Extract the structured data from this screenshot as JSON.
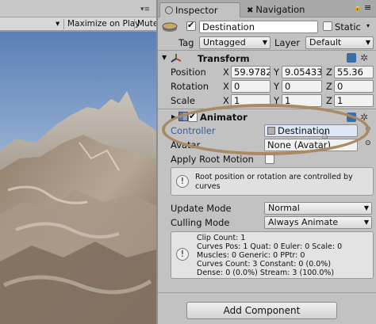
{
  "game_toolbar": {
    "dropdown": "",
    "maximize": "Maximize on Play",
    "mute": "Mute"
  },
  "tabs": {
    "inspector": "Inspector",
    "navigation": "Navigation"
  },
  "object": {
    "name": "Destination",
    "static_label": "Static",
    "tag_label": "Tag",
    "tag_value": "Untagged",
    "layer_label": "Layer",
    "layer_value": "Default"
  },
  "transform": {
    "title": "Transform",
    "position_label": "Position",
    "rotation_label": "Rotation",
    "scale_label": "Scale",
    "axis_x": "X",
    "axis_y": "Y",
    "axis_z": "Z",
    "position": [
      "59.9782",
      "9.05433",
      "55.36"
    ],
    "rotation": [
      "0",
      "0",
      "0"
    ],
    "scale": [
      "1",
      "1",
      "1"
    ]
  },
  "animator": {
    "title": "Animator",
    "controller_label": "Controller",
    "controller_value": "Destination",
    "avatar_label": "Avatar",
    "avatar_value": "None (Avatar)",
    "apply_root_motion_label": "Apply Root Motion",
    "help_text": "Root position or rotation are controlled by curves",
    "update_mode_label": "Update Mode",
    "update_mode_value": "Normal",
    "culling_mode_label": "Culling Mode",
    "culling_mode_value": "Always Animate",
    "info_lines": [
      "Clip Count: 1",
      "Curves Pos: 1 Quat: 0 Euler: 0 Scale: 0",
      "Muscles: 0 Generic: 0 PPtr: 0",
      "Curves Count: 3 Constant: 0 (0.0%)",
      "Dense: 0 (0.0%) Stream: 3 (100.0%)"
    ]
  },
  "add_component": "Add Component",
  "icons": {
    "gameobject": "cube-icon",
    "transform": "transform-axes-icon",
    "animator": "animator-icon",
    "help": "help-book-icon",
    "gear": "gear-icon",
    "info": "info-icon",
    "lock": "lock-icon",
    "menu": "menu-icon"
  },
  "colors": {
    "highlight_ring": "#a98a63",
    "controller_label": "#3a5a9a",
    "selected_field": "#dce6f5"
  }
}
